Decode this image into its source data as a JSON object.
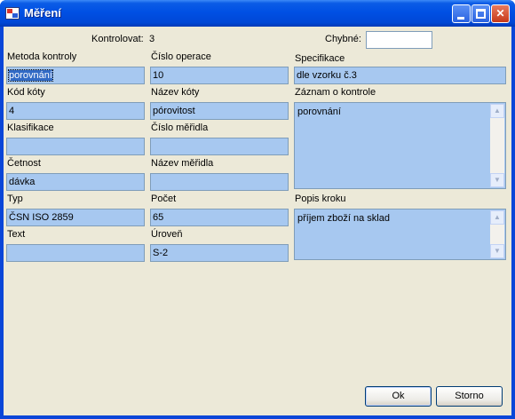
{
  "window": {
    "title": "Měření"
  },
  "header": {
    "kontrolovat_label": "Kontrolovat:",
    "kontrolovat_value": "3",
    "chybne_label": "Chybné:",
    "chybne_value": ""
  },
  "col1": {
    "metoda_label": "Metoda kontroly",
    "metoda_value": "porovnání",
    "kod_label": "Kód kóty",
    "kod_value": "4",
    "klasifikace_label": "Klasifikace",
    "klasifikace_value": "",
    "cetnost_label": "Četnost",
    "cetnost_value": "dávka",
    "typ_label": "Typ",
    "typ_value": "ČSN ISO 2859",
    "text_label": "Text",
    "text_value": ""
  },
  "col2": {
    "cislo_operace_label": "Číslo operace",
    "cislo_operace_value": "10",
    "nazev_koty_label": "Název kóty",
    "nazev_koty_value": "pórovitost",
    "cislo_meridla_label": "Číslo měřidla",
    "cislo_meridla_value": "",
    "nazev_meridla_label": "Název měřidla",
    "nazev_meridla_value": "",
    "pocet_label": "Počet",
    "pocet_value": "65",
    "uroven_label": "Úroveň",
    "uroven_value": "S-2"
  },
  "col3": {
    "specifikace_label": "Specifikace",
    "specifikace_value": "dle vzorku č.3",
    "zaznam_label": "Záznam o kontrole",
    "zaznam_value": "porovnání",
    "popis_label": "Popis kroku",
    "popis_value": "příjem zboží na sklad"
  },
  "buttons": {
    "ok": "Ok",
    "cancel": "Storno"
  },
  "icons": {
    "app": "app-icon",
    "minimize": "minimize-icon",
    "maximize": "maximize-icon",
    "close": "close-icon",
    "scroll_up": "scroll-up-icon",
    "scroll_down": "scroll-down-icon"
  },
  "colors": {
    "field_bg": "#a7c8f0",
    "selection": "#316ac5",
    "dialog_bg": "#ece9d8",
    "titlebar": "#0050e4"
  }
}
